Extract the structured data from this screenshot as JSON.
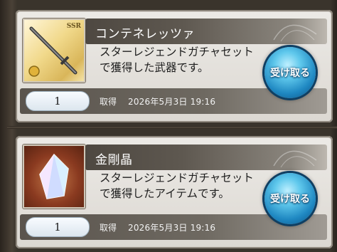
{
  "items": [
    {
      "name": "コンテネレッツァ",
      "description": "スターレジェンドガチャセットで獲得した武器です。",
      "quantity": "1",
      "acquired_label": "取得",
      "acquired_date": "2026年5月3日 19:16",
      "receive_label": "受け取る",
      "thumbnail_icon": "sword-icon",
      "rarity_badge": "SSR"
    },
    {
      "name": "金剛晶",
      "description": "スターレジェンドガチャセットで獲得したアイテムです。",
      "quantity": "1",
      "acquired_label": "取得",
      "acquired_date": "2026年5月3日 19:16",
      "receive_label": "受け取る",
      "thumbnail_icon": "crystal-icon"
    }
  ],
  "colors": {
    "receive_button": "#1f88c2",
    "card_background": "#e6e3de",
    "title_bar": "#4e4841"
  }
}
